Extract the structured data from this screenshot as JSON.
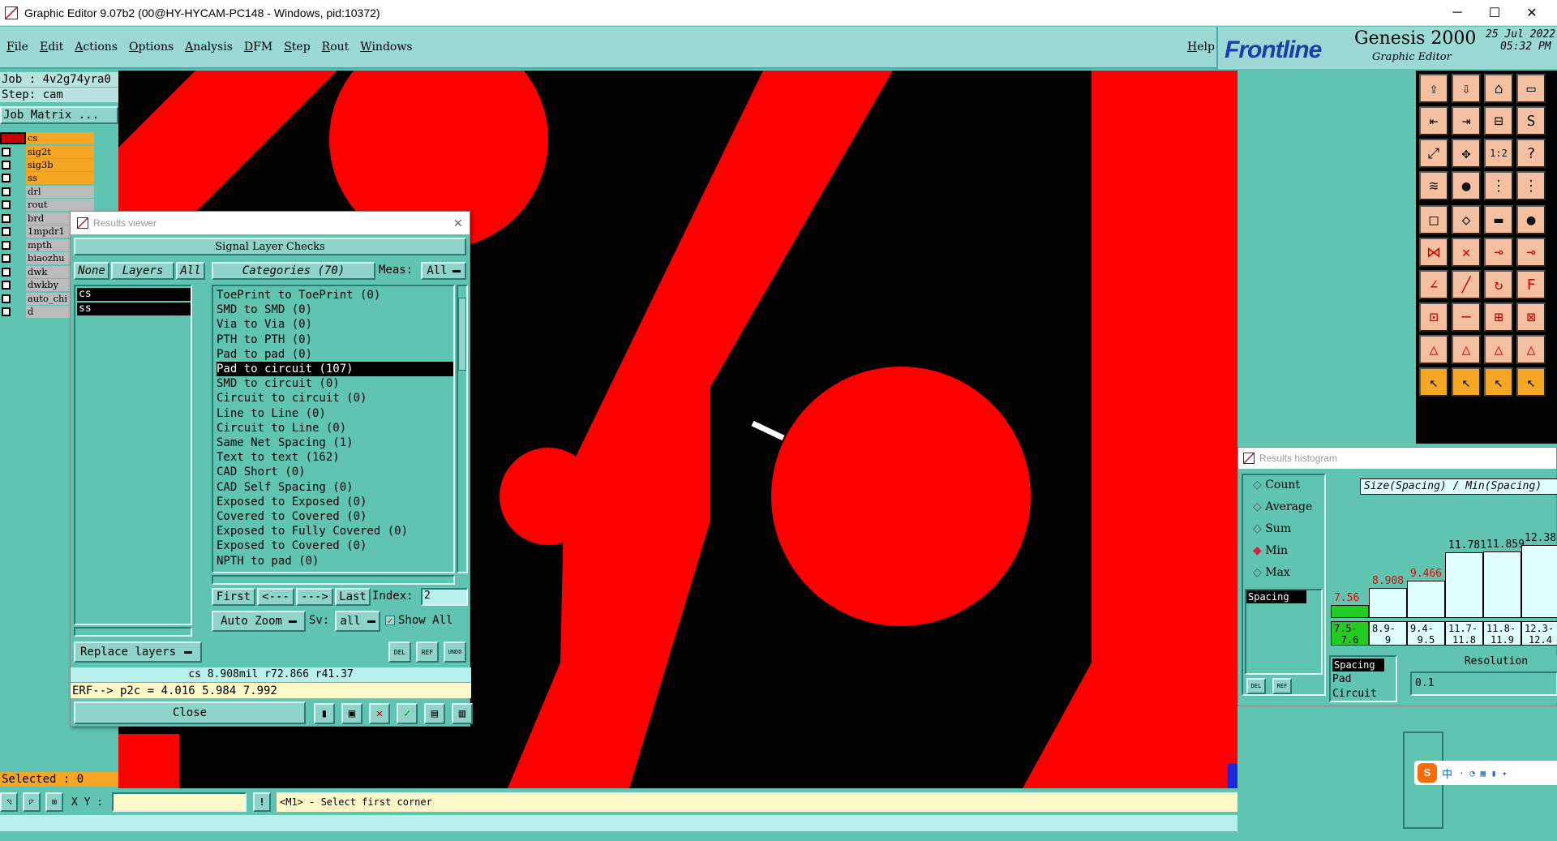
{
  "window": {
    "title": "Graphic Editor 9.07b2 (00@HY-HYCAM-PC148 - Windows, pid:10372)",
    "minimize": "─",
    "maximize": "☐",
    "close": "✕"
  },
  "menu": {
    "items": [
      "File",
      "Edit",
      "Actions",
      "Options",
      "Analysis",
      "DFM",
      "Step",
      "Rout",
      "Windows"
    ],
    "help": "Help"
  },
  "brand": {
    "logo": "Frontline",
    "product": "Genesis 2000",
    "subtitle": "Graphic Editor",
    "date": "25 Jul 2022",
    "time": "05:32 PM"
  },
  "left_panel": {
    "job": "Job : 4v2g74yra0",
    "step": "Step: cam",
    "job_matrix": "Job Matrix ...",
    "layers": [
      {
        "name": "cs",
        "color": "#f5a623"
      },
      {
        "name": "sig2t",
        "color": "#f5a623"
      },
      {
        "name": "sig3b",
        "color": "#f5a623"
      },
      {
        "name": "ss",
        "color": "#f5a623"
      },
      {
        "name": "drl",
        "color": "#bbbbbb"
      },
      {
        "name": "rout",
        "color": "#bbbbbb"
      },
      {
        "name": "brd",
        "color": "#bbbbbb"
      },
      {
        "name": "1mpdr1",
        "color": "#bbbbbb"
      },
      {
        "name": "mpth",
        "color": "#bbbbbb"
      },
      {
        "name": "biaozhu",
        "color": "#bbbbbb"
      },
      {
        "name": "dwk",
        "color": "#bbbbbb"
      },
      {
        "name": "dwkby",
        "color": "#bbbbbb"
      },
      {
        "name": "auto_chi",
        "color": "#bbbbbb"
      },
      {
        "name": "d",
        "color": "#bbbbbb"
      }
    ],
    "selected": "Selected : 0"
  },
  "results_viewer": {
    "title": "Results viewer",
    "close_x": "✕",
    "header": "Signal Layer Checks",
    "none_btn": "None",
    "layers_btn": "Layers",
    "all_btn": "All",
    "categories_btn": "Categories (70)",
    "meas_label": "Meas:",
    "meas_value": "All",
    "layer_list": [
      "cs",
      "ss"
    ],
    "categories": [
      "ToePrint to ToePrint (0)",
      "SMD to SMD (0)",
      "Via to Via (0)",
      "PTH to PTH (0)",
      "Pad to pad (0)",
      "Pad to circuit (107)",
      "SMD to circuit (0)",
      "Circuit to circuit (0)",
      "Line to Line (0)",
      "Circuit to Line (0)",
      "Same Net Spacing (1)",
      "Text to text (162)",
      "CAD Short (0)",
      "CAD Self Spacing (0)",
      "Exposed to Exposed (0)",
      "Covered to Covered (0)",
      "Exposed to Fully Covered (0)",
      "Exposed to Covered (0)",
      "NPTH to pad (0)"
    ],
    "selected_index": 5,
    "first_btn": "First",
    "prev_btn": "<---",
    "next_btn": "--->",
    "last_btn": "Last",
    "index_label": "Index:",
    "index_value": "2",
    "auto_zoom": "Auto Zoom",
    "sv_label": "Sv:",
    "sv_value": "all",
    "show_all": "Show All",
    "replace_layers": "Replace layers",
    "del_icon": "DEL",
    "ref_icon": "REF",
    "undo_icon": "UNDO",
    "measure_line": "cs 8.908mil  r72.866  r41.37",
    "erf_line": "ERF--> p2c = 4.016 5.984 7.992",
    "close_btn": "Close"
  },
  "histogram": {
    "title": "Results histogram",
    "options": [
      "Count",
      "Average",
      "Sum",
      "Min",
      "Max"
    ],
    "selected_option": "Min",
    "list_item": "Spacing",
    "header": "Size(Spacing) / Min(Spacing)",
    "bars": [
      {
        "label": "7.56",
        "bin_top": "7.5-",
        "bin_bottom": "7.6",
        "value": 7.56,
        "color": "#22cc22"
      },
      {
        "label": "8.908",
        "bin_top": "8.9-",
        "bin_bottom": "9",
        "value": 8.908,
        "color": "#dfffff"
      },
      {
        "label": "9.466",
        "bin_top": "9.4-",
        "bin_bottom": "9.5",
        "value": 9.466,
        "color": "#dfffff"
      },
      {
        "label": "11.781",
        "bin_top": "11.7-",
        "bin_bottom": "11.8",
        "value": 11.781,
        "color": "#dfffff"
      },
      {
        "label": "11.859",
        "bin_top": "11.8-",
        "bin_bottom": "11.9",
        "value": 11.859,
        "color": "#dfffff"
      },
      {
        "label": "12.38",
        "bin_top": "12.3-",
        "bin_bottom": "12.4",
        "value": 12.38,
        "color": "#dfffff"
      }
    ],
    "legend": [
      "Spacing",
      "Pad",
      "Circuit"
    ],
    "resolution_label": "Resolution",
    "resolution_value": "0.1",
    "del_icon": "DEL",
    "ref_icon": "REF"
  },
  "statusbar": {
    "xy_label": "X Y :",
    "xy_value": "",
    "prompt": "<M1> - Select first corner"
  },
  "ime": {
    "logo": "S",
    "lang": "中"
  }
}
